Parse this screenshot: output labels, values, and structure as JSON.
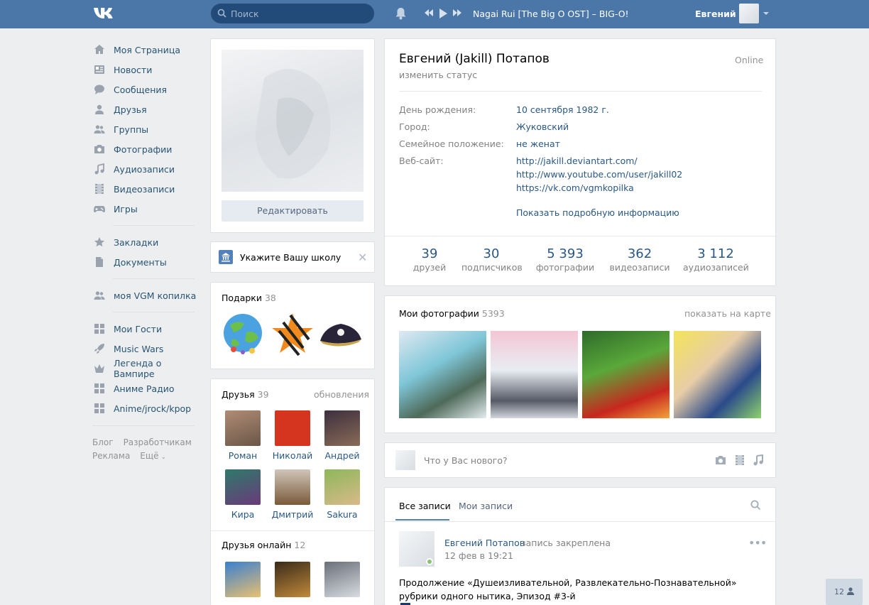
{
  "header": {
    "logo": "VK",
    "search_placeholder": "Поиск",
    "track": "Nagai Rui [The Big O OST] – BIG-O!",
    "user_name": "Евгений"
  },
  "nav": {
    "items": [
      {
        "label": "Моя Страница",
        "icon": "home-icon"
      },
      {
        "label": "Новости",
        "icon": "news-icon"
      },
      {
        "label": "Сообщения",
        "icon": "messages-icon"
      },
      {
        "label": "Друзья",
        "icon": "friends-icon"
      },
      {
        "label": "Группы",
        "icon": "groups-icon"
      },
      {
        "label": "Фотографии",
        "icon": "camera-icon"
      },
      {
        "label": "Аудиозаписи",
        "icon": "music-icon"
      },
      {
        "label": "Видеозаписи",
        "icon": "video-icon"
      },
      {
        "label": "Игры",
        "icon": "gamepad-icon"
      }
    ],
    "items2": [
      {
        "label": "Закладки",
        "icon": "star-icon"
      },
      {
        "label": "Документы",
        "icon": "document-icon"
      }
    ],
    "items3": [
      {
        "label": "моя VGM копилка",
        "icon": "group-icon"
      }
    ],
    "apps": [
      {
        "label": "Мои Гости",
        "icon": "app-grid-icon"
      },
      {
        "label": "Music Wars",
        "icon": "rocket-icon"
      },
      {
        "label": "Легенда о Вампире",
        "icon": "crown-icon"
      },
      {
        "label": "Аниме Радио",
        "icon": "app-grid-icon"
      },
      {
        "label": "Anime/jrock/kpop",
        "icon": "app-grid-icon"
      }
    ],
    "footer": [
      "Блог",
      "Разработчикам",
      "Реклама",
      "Ещё"
    ]
  },
  "avatar": {
    "edit_label": "Редактировать"
  },
  "school": {
    "label": "Укажите Вашу школу"
  },
  "gifts": {
    "title": "Подарки",
    "count": "38"
  },
  "friends": {
    "title": "Друзья",
    "count": "39",
    "updates": "обновления",
    "list": [
      "Роман",
      "Николай",
      "Андрей",
      "Кира",
      "Дмитрий",
      "Sakura"
    ],
    "online_title": "Друзья онлайн",
    "online_count": "12"
  },
  "profile": {
    "name": "Евгений (Jakill) Потапов",
    "status": "изменить статус",
    "online": "Online",
    "info": [
      {
        "label": "День рождения:",
        "value": "10 сентября 1982 г."
      },
      {
        "label": "Город:",
        "value": "Жуковский"
      },
      {
        "label": "Семейное положение:",
        "value": "не женат"
      },
      {
        "label": "Веб-сайт:",
        "value": "http://jakill.deviantart.com/"
      }
    ],
    "sites_extra": [
      "http://www.youtube.com/user/jakill02",
      "https://vk.com/vgmkopilka"
    ],
    "show_more": "Показать подробную информацию",
    "counters": [
      {
        "num": "39",
        "label": "друзей"
      },
      {
        "num": "30",
        "label": "подписчиков"
      },
      {
        "num": "5 393",
        "label": "фотографии"
      },
      {
        "num": "362",
        "label": "видеозаписи"
      },
      {
        "num": "3 112",
        "label": "аудиозаписей"
      }
    ]
  },
  "photos": {
    "title": "Мои фотографии",
    "count": "5393",
    "map_link": "показать на карте"
  },
  "post_box": {
    "placeholder": "Что у Вас нового?"
  },
  "wall": {
    "tab_all": "Все записи",
    "tab_mine": "Мои записи",
    "author": "Евгений Потапов",
    "pinned": "запись закреплена",
    "date": "12 фев в 19:21",
    "text": "Продолжение «Душеизливательной, Развлекательно-Познавательной» рубрики одного нытика, Эпизод #3-й"
  },
  "corner": {
    "count": "12"
  },
  "colors": {
    "header": "#4a76a8",
    "link": "#2a5885",
    "accent": "#5181b8",
    "bg": "#edeef0"
  }
}
